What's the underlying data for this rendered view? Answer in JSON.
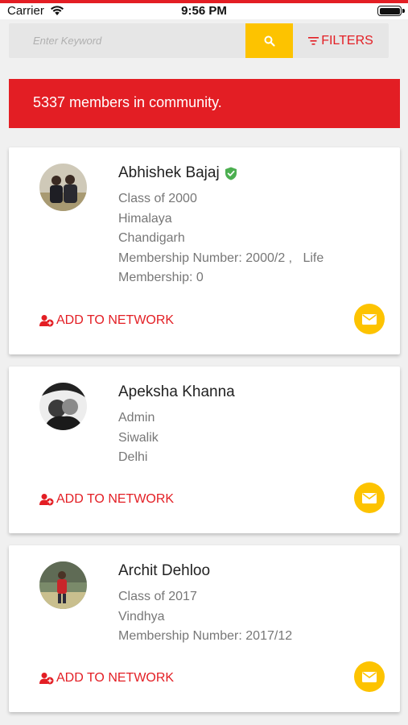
{
  "status_bar": {
    "carrier": "Carrier",
    "time": "9:56 PM"
  },
  "search": {
    "placeholder": "Enter Keyword",
    "value": "",
    "button_icon": "search-icon"
  },
  "filters": {
    "label": "FILTERS",
    "icon": "filter-icon"
  },
  "banner": {
    "text": "5337 members in community."
  },
  "colors": {
    "accent_red": "#e31e24",
    "accent_yellow": "#fdc300",
    "verified_green": "#4caf50"
  },
  "members": [
    {
      "name": "Abhishek Bajaj",
      "verified": true,
      "details": [
        "Class of 2000",
        "Himalaya",
        "Chandigarh",
        "Membership Number: 2000/2 ,   Life",
        "Membership: 0"
      ],
      "action_label": "ADD TO NETWORK"
    },
    {
      "name": "Apeksha Khanna",
      "verified": false,
      "details": [
        "Admin",
        "Siwalik",
        "Delhi"
      ],
      "action_label": "ADD TO NETWORK"
    },
    {
      "name": "Archit Dehloo",
      "verified": false,
      "details": [
        "Class of 2017",
        "Vindhya",
        "Membership Number: 2017/12"
      ],
      "action_label": "ADD TO NETWORK"
    }
  ]
}
